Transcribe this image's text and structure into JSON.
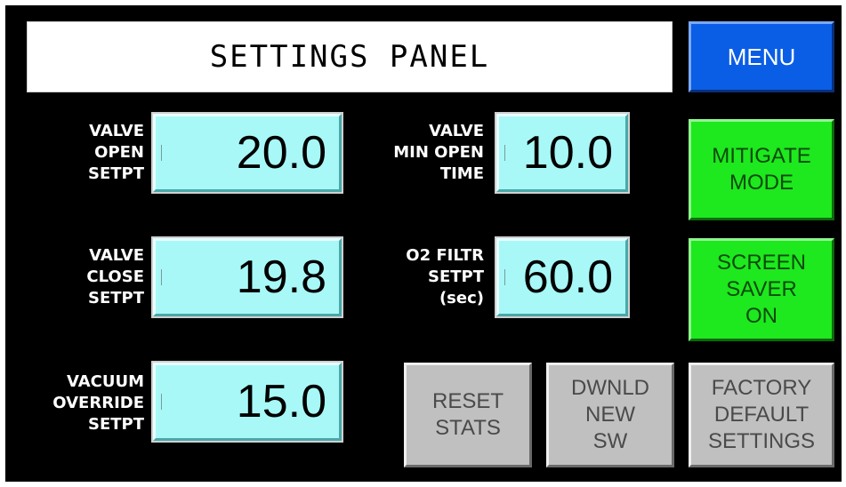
{
  "header": {
    "title": "SETTINGS PANEL",
    "menu_label": "MENU"
  },
  "fields": {
    "valve_open": {
      "label": [
        "VALVE",
        "OPEN",
        "SETPT"
      ],
      "value": "20.0"
    },
    "valve_close": {
      "label": [
        "VALVE",
        "CLOSE",
        "SETPT"
      ],
      "value": "19.8"
    },
    "vacuum_override": {
      "label": [
        "VACUUM",
        "OVERRIDE",
        "SETPT"
      ],
      "value": "15.0"
    },
    "valve_min_open": {
      "label": [
        "VALVE",
        "MIN OPEN",
        "TIME"
      ],
      "value": "10.0"
    },
    "o2_filter": {
      "label": [
        "O2 FILTR",
        "SETPT",
        "(sec)"
      ],
      "value": "60.0"
    }
  },
  "buttons": {
    "mitigate": [
      "MITIGATE",
      "MODE"
    ],
    "screen_saver": [
      "SCREEN",
      "SAVER",
      "ON"
    ],
    "reset_stats": [
      "RESET",
      "STATS"
    ],
    "download_sw": [
      "DWNLD",
      "NEW",
      "SW"
    ],
    "factory_defaults": [
      "FACTORY",
      "DEFAULT",
      "SETTINGS"
    ]
  },
  "colors": {
    "background": "#000000",
    "value_box": "#a8f8f8",
    "menu_button": "#0a5ee6",
    "green_button": "#1ee81e",
    "gray_button": "#c0c0c0"
  }
}
